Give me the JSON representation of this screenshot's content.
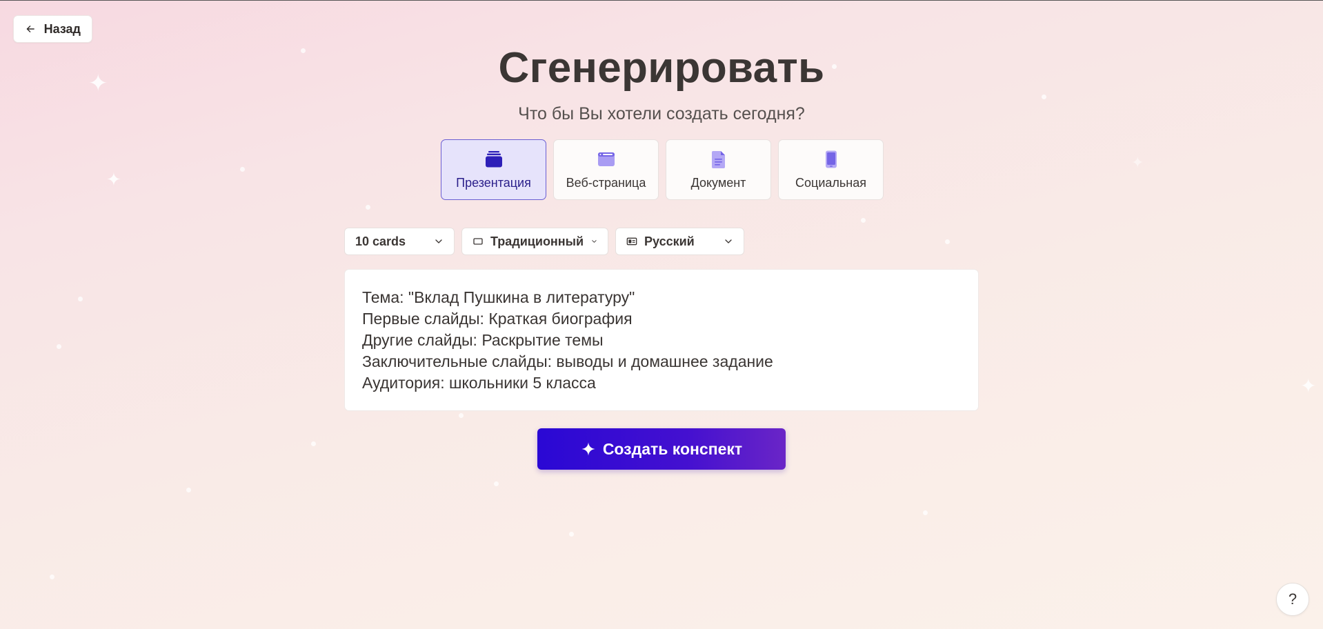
{
  "nav": {
    "back_label": "Назад"
  },
  "header": {
    "title": "Сгенерировать",
    "subtitle": "Что бы Вы хотели создать сегодня?"
  },
  "types": [
    {
      "label": "Презентация",
      "icon": "presentation-icon",
      "active": true
    },
    {
      "label": "Веб-страница",
      "icon": "webpage-icon",
      "active": false
    },
    {
      "label": "Документ",
      "icon": "document-icon",
      "active": false
    },
    {
      "label": "Социальная",
      "icon": "social-phone-icon",
      "active": false
    }
  ],
  "options": {
    "cards": "10 cards",
    "style": "Традиционный",
    "language": "Русский"
  },
  "prompt": {
    "lines": [
      "Тема: \"Вклад Пушкина в литературу\"",
      "Первые слайды: Краткая биография",
      "Другие слайды: Раскрытие темы",
      "Заключительные слайды: выводы и домашнее задание",
      "Аудитория: школьники 5 класса"
    ]
  },
  "actions": {
    "create_label": "Создать конспект",
    "help_label": "?"
  },
  "colors": {
    "accent": "#2a08d4",
    "accent_end": "#6a25c7",
    "active_card_bg": "#e6e3fb",
    "icon_purple": "#8b7cf0"
  }
}
